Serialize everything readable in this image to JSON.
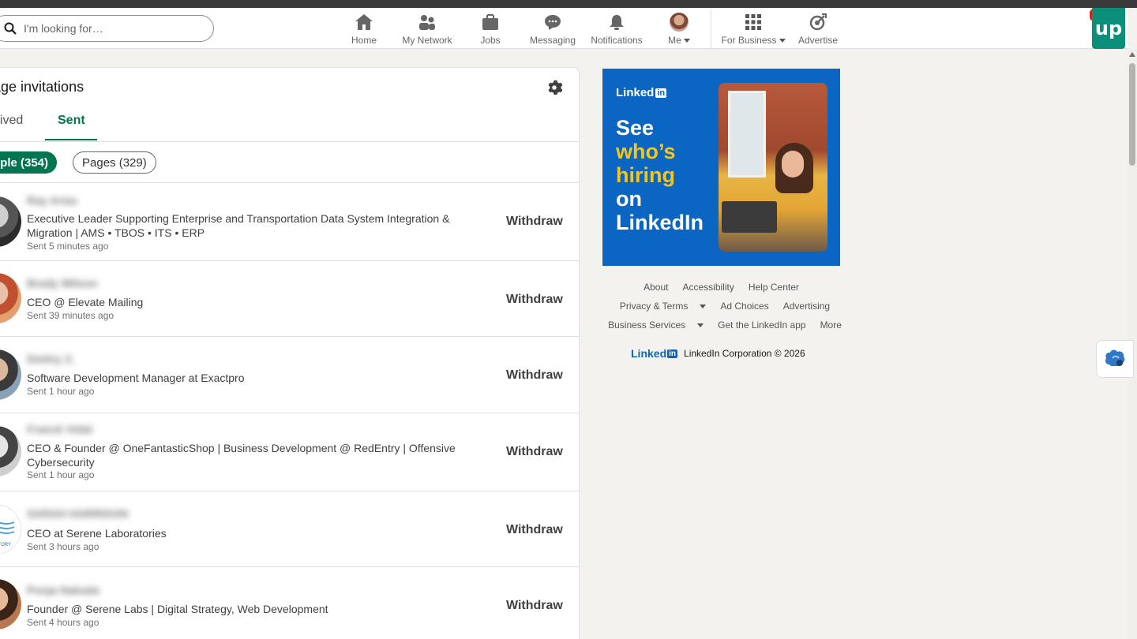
{
  "search": {
    "placeholder": "I'm looking for…"
  },
  "nav": {
    "home": "Home",
    "network": "My Network",
    "jobs": "Jobs",
    "messaging": "Messaging",
    "notifications": "Notifications",
    "me": "Me",
    "business": "For Business",
    "advertise": "Advertise"
  },
  "extension": {
    "label": "up"
  },
  "card": {
    "title": "age invitations",
    "tabs": {
      "received": "eived",
      "sent": "Sent"
    },
    "pills": {
      "people": "ople (354)",
      "pages": "Pages (329)"
    }
  },
  "invitations": [
    {
      "name": "Ray Arias",
      "headline": "Executive Leader Supporting Enterprise and Transportation Data System Integration & Migration | AMS • TBOS • ITS • ERP",
      "time": "Sent 5 minutes ago",
      "action": "Withdraw"
    },
    {
      "name": "Brady Wilson",
      "headline": "CEO @ Elevate Mailing",
      "time": "Sent 39 minutes ago",
      "action": "Withdraw"
    },
    {
      "name": "Dmitry Z.",
      "headline": "Software Development Manager at Exactpro",
      "time": "Sent 1 hour ago",
      "action": "Withdraw"
    },
    {
      "name": "Franck Vidal",
      "headline": "CEO & Founder @ OneFantasticShop | Business Development @ RedEntry | Offensive Cybersecurity",
      "time": "Sent 1 hour ago",
      "action": "Withdraw"
    },
    {
      "name": "SARAH HARRISON",
      "headline": "CEO at Serene Laboratories",
      "time": "Sent 3 hours ago",
      "action": "Withdraw"
    },
    {
      "name": "Pooja Nakada",
      "headline": "Founder @ Serene Labs | Digital Strategy, Web Development",
      "time": "Sent 4 hours ago",
      "action": "Withdraw"
    }
  ],
  "ad": {
    "brand": "Linked",
    "brand_in": "in",
    "line1": "See",
    "line2": "who’s",
    "line3": "hiring",
    "line4": "on",
    "line5": "LinkedIn",
    "colors": {
      "background": "#0a66c2",
      "highlight": "#f5c518",
      "text": "#ffffff"
    }
  },
  "footer": {
    "about": "About",
    "accessibility": "Accessibility",
    "help": "Help Center",
    "privacy": "Privacy & Terms",
    "adchoices": "Ad Choices",
    "advertising": "Advertising",
    "business": "Business Services",
    "app": "Get the LinkedIn app",
    "more": "More",
    "logo": "Linked",
    "logo_in": "in",
    "copyright": "LinkedIn Corporation © 2026"
  },
  "colors": {
    "accent": "#01754f",
    "brand": "#0a66c2"
  }
}
